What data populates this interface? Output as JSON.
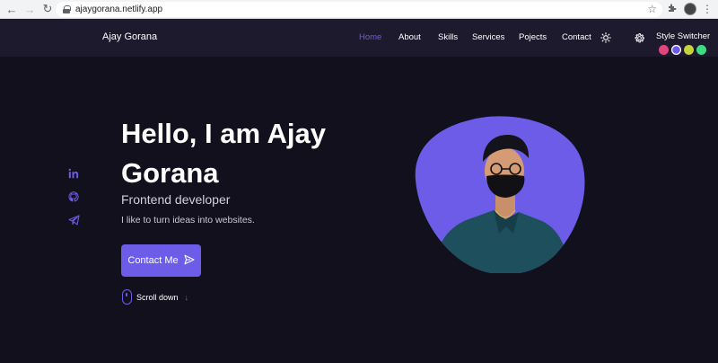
{
  "browser": {
    "url": "ajaygorana.netlify.app"
  },
  "header": {
    "logo": "Ajay Gorana",
    "menu": [
      "Home",
      "About",
      "Skills",
      "Services",
      "Pojects",
      "Contact"
    ],
    "style_switcher": "Style Switcher",
    "swatch_colors": [
      "#e0457b",
      "#6c5ce7",
      "#c7d33d",
      "#3ddc84"
    ],
    "accent_color": "#6c5ce7"
  },
  "social": {
    "icons": [
      "linkedin-icon",
      "github-icon",
      "telegram-icon"
    ]
  },
  "hero": {
    "title": "Hello, I am Ajay Gorana",
    "subtitle": "Frontend developer",
    "description": "I like to turn ideas into websites.",
    "contact_button": "Contact Me",
    "scroll_label": "Scroll down"
  }
}
